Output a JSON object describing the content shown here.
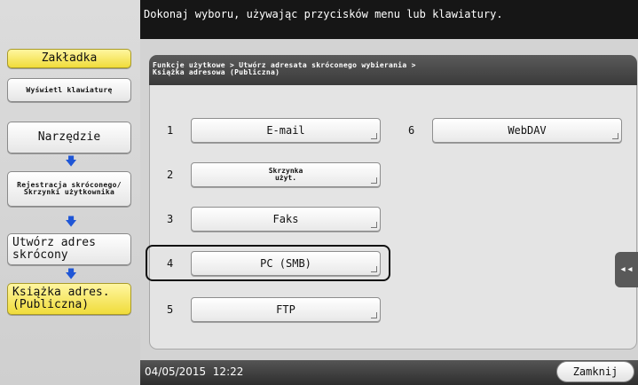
{
  "header": {
    "instruction": "Dokonaj wyboru, używając przycisków menu lub klawiatury."
  },
  "sidebar": {
    "tab_label": "Zakładka",
    "keyboard_label": "Wyświetl klawiaturę",
    "steps": [
      {
        "label": "Narzędzie"
      },
      {
        "label": "Rejestracja skróconego/ Skrzynki użytkownika"
      },
      {
        "label": "Utwórz adres skrócony"
      },
      {
        "label": "Książka adres. (Publiczna)"
      }
    ],
    "arrow_glyph": "🡇"
  },
  "breadcrumb": {
    "line1": "Funkcje użytkowe > Utwórz adresata skróconego wybierania >",
    "line2": "Książka adresowa (Publiczna)"
  },
  "functions": [
    {
      "number": "1",
      "label": "E-mail"
    },
    {
      "number": "2",
      "label": "Skrzynka użyt."
    },
    {
      "number": "3",
      "label": "Faks"
    },
    {
      "number": "4",
      "label": "PC (SMB)"
    },
    {
      "number": "5",
      "label": "FTP"
    },
    {
      "number": "6",
      "label": "WebDAV"
    }
  ],
  "side_tab": {
    "icon": "collapse-left-icon",
    "glyph": "◂◂"
  },
  "footer": {
    "datetime": "04/05/2015  12:22",
    "close_label": "Zamknij"
  },
  "colors": {
    "highlight_yellow": "#f0dc3a",
    "arrow_blue": "#1f56d6",
    "header_bg": "#161616"
  }
}
